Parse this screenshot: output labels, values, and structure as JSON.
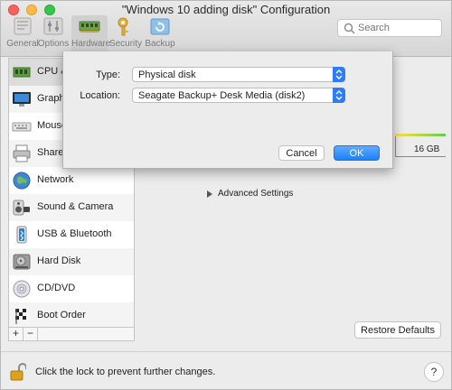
{
  "window": {
    "title": "\"Windows 10 adding disk\" Configuration"
  },
  "toolbar": {
    "items": [
      {
        "label": "General",
        "icon": "general-icon"
      },
      {
        "label": "Options",
        "icon": "options-icon"
      },
      {
        "label": "Hardware",
        "icon": "hardware-icon",
        "active": true
      },
      {
        "label": "Security",
        "icon": "key-icon"
      },
      {
        "label": "Backup",
        "icon": "backup-icon"
      }
    ],
    "search_placeholder": "Search"
  },
  "sidebar": {
    "items": [
      {
        "label": "CPU & Memory",
        "icon": "cpu-icon"
      },
      {
        "label": "Graphics",
        "icon": "graphics-icon"
      },
      {
        "label": "Mouse & Keyboard",
        "icon": "keyboard-icon"
      },
      {
        "label": "Shared Printers",
        "icon": "printer-icon"
      },
      {
        "label": "Network",
        "icon": "network-icon"
      },
      {
        "label": "Sound & Camera",
        "icon": "speaker-icon"
      },
      {
        "label": "USB & Bluetooth",
        "icon": "usb-icon"
      },
      {
        "label": "Hard Disk",
        "icon": "harddisk-icon"
      },
      {
        "label": "CD/DVD",
        "icon": "cd-icon"
      },
      {
        "label": "Boot Order",
        "icon": "boot-order-icon"
      }
    ],
    "add_label": "+",
    "remove_label": "−"
  },
  "main": {
    "size_label": "16 GB",
    "advanced_label": "Advanced Settings",
    "restore_label": "Restore Defaults"
  },
  "dialog": {
    "type_label": "Type:",
    "type_value": "Physical disk",
    "location_label": "Location:",
    "location_value": "Seagate Backup+ Desk Media (disk2)",
    "cancel_label": "Cancel",
    "ok_label": "OK"
  },
  "footer": {
    "lock_text": "Click the lock to prevent further changes.",
    "help_label": "?"
  },
  "colors": {
    "accent": "#1a82fb",
    "traffic_close": "#fc605c",
    "traffic_min": "#fdbc40",
    "traffic_max": "#34c84a"
  }
}
